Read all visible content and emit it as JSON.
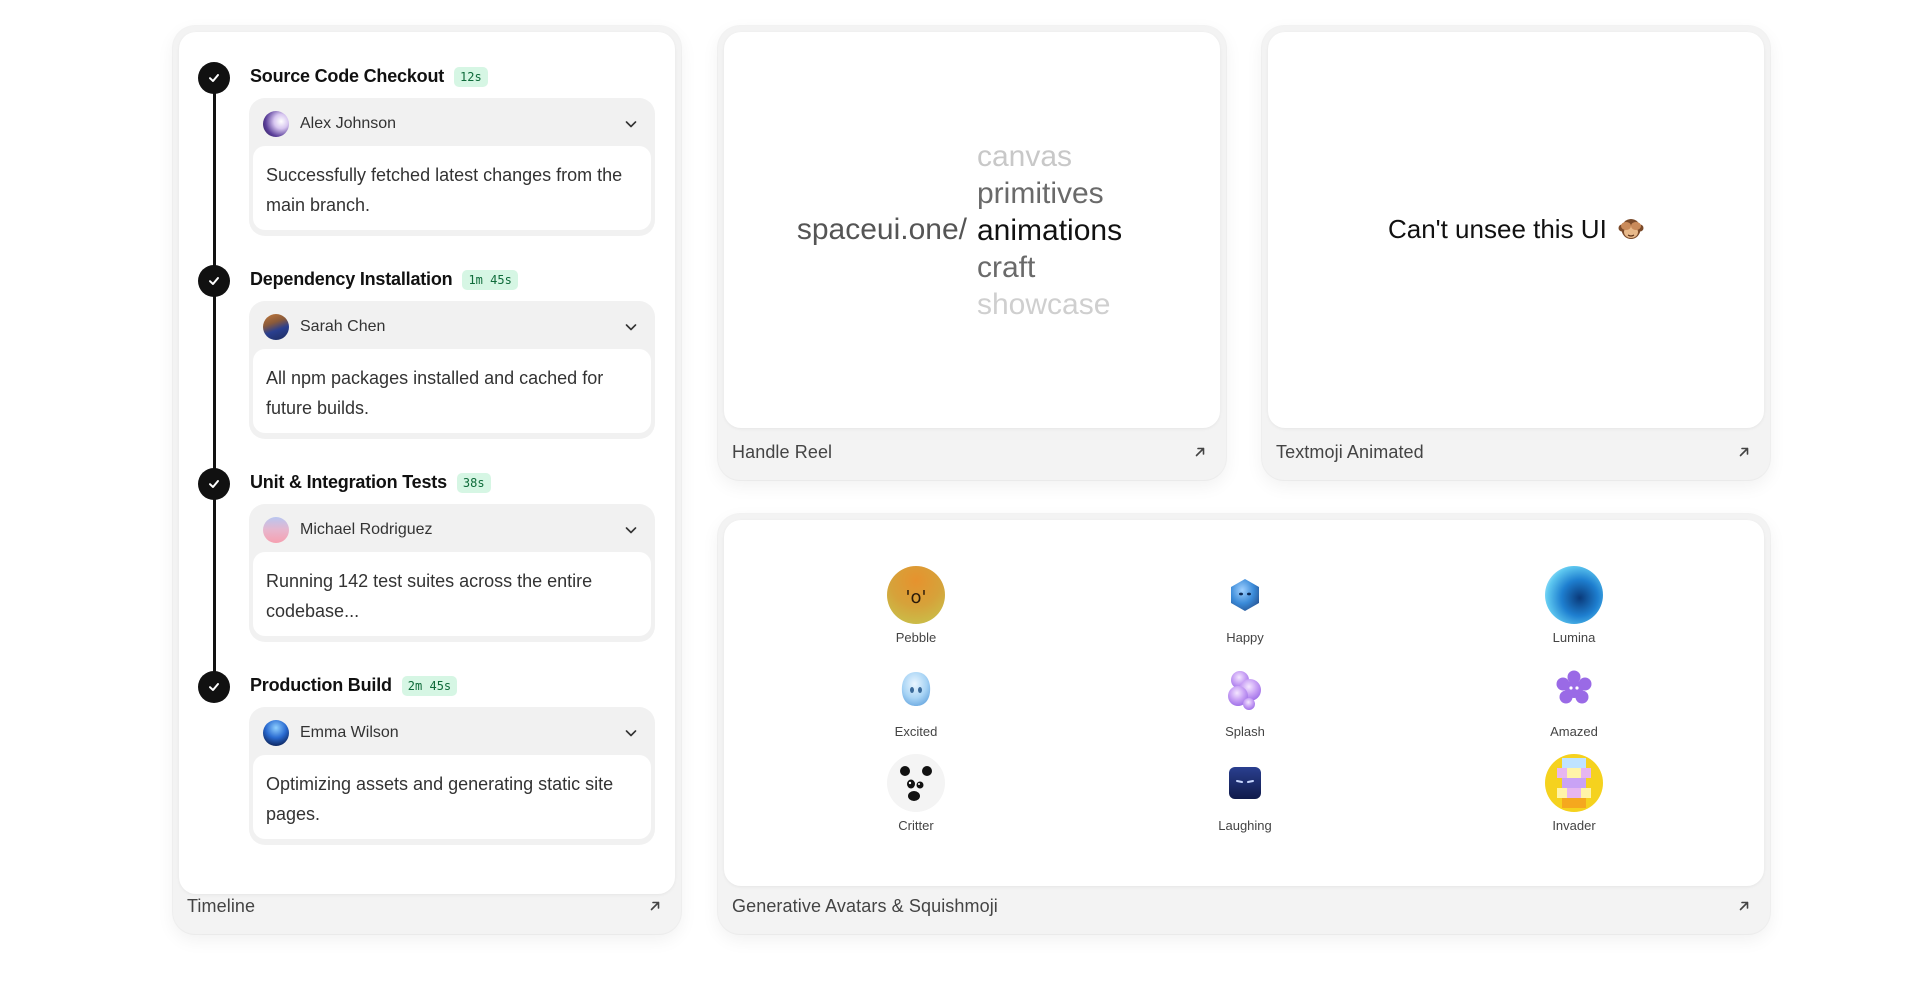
{
  "timeline": {
    "footer_label": "Timeline",
    "steps": [
      {
        "title": "Source Code Checkout",
        "duration": "12s",
        "user": "Alex Johnson",
        "message": "Successfully fetched latest changes from the main branch."
      },
      {
        "title": "Dependency Installation",
        "duration": "1m 45s",
        "user": "Sarah Chen",
        "message": "All npm packages installed and cached for future builds."
      },
      {
        "title": "Unit & Integration Tests",
        "duration": "38s",
        "user": "Michael Rodriguez",
        "message": "Running 142 test suites across the entire codebase..."
      },
      {
        "title": "Production Build",
        "duration": "2m 45s",
        "user": "Emma Wilson",
        "message": "Optimizing assets and generating static site pages."
      }
    ]
  },
  "handle_reel": {
    "footer_label": "Handle Reel",
    "prefix": "spaceui.one/",
    "words": [
      "canvas",
      "primitives",
      "animations",
      "craft",
      "showcase"
    ]
  },
  "textmoji": {
    "footer_label": "Textmoji Animated",
    "text": "Can't unsee this UI",
    "emoji_icon": "see-no-evil-monkey-icon"
  },
  "avatars": {
    "footer_label": "Generative Avatars & Squishmoji",
    "items": [
      {
        "label": "Pebble",
        "icon": "pebble-avatar-icon"
      },
      {
        "label": "Happy",
        "icon": "happy-squishmoji-icon"
      },
      {
        "label": "Lumina",
        "icon": "lumina-avatar-icon"
      },
      {
        "label": "Excited",
        "icon": "excited-squishmoji-icon"
      },
      {
        "label": "Splash",
        "icon": "splash-avatar-icon"
      },
      {
        "label": "Amazed",
        "icon": "amazed-squishmoji-icon"
      },
      {
        "label": "Critter",
        "icon": "critter-avatar-icon"
      },
      {
        "label": "Laughing",
        "icon": "laughing-squishmoji-icon"
      },
      {
        "label": "Invader",
        "icon": "invader-avatar-icon"
      }
    ]
  },
  "colors": {
    "badge_bg": "#d6f6e4",
    "badge_text": "#0f6b3a",
    "check_bg": "#111111",
    "card_bg": "#f3f3f3"
  }
}
